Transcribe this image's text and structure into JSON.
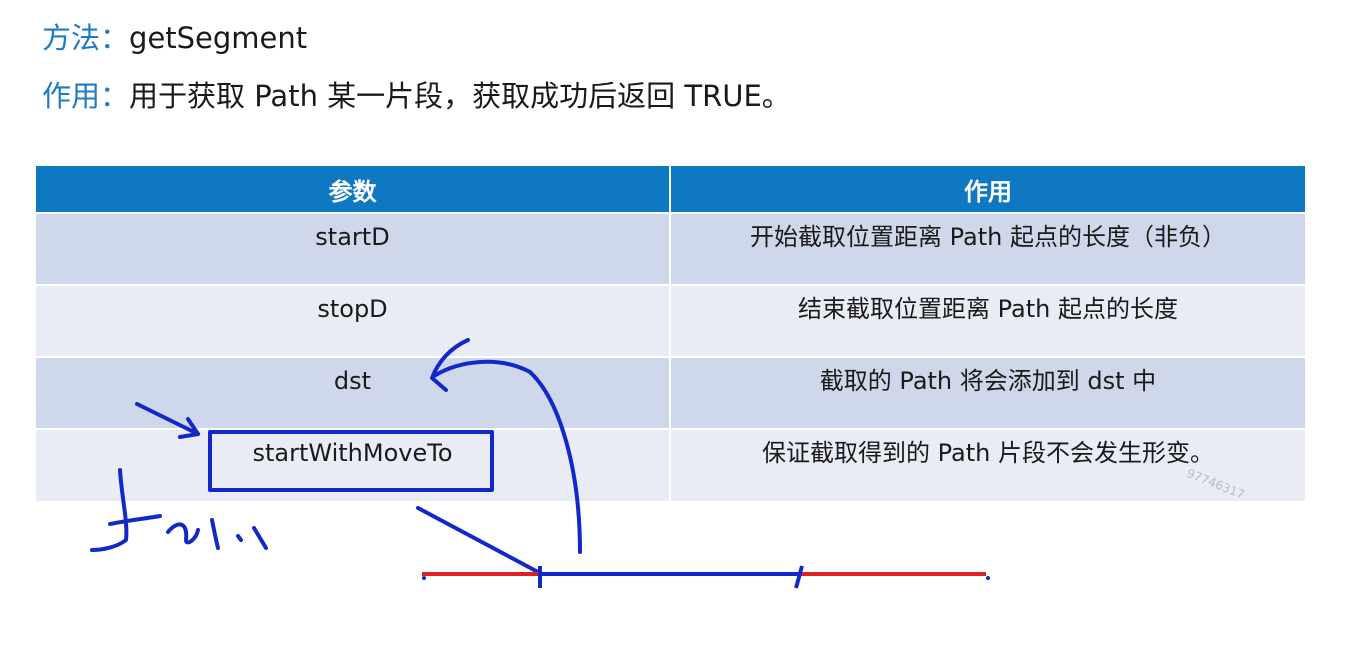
{
  "header": {
    "method_key": "方法",
    "method_value": "getSegment",
    "effect_key": "作用",
    "effect_value": "用于获取 Path 某一片段，获取成功后返回 TRUE。",
    "separator": "："
  },
  "table": {
    "columns": [
      "参数",
      "作用"
    ],
    "rows": [
      {
        "param": "startD",
        "effect": "开始截取位置距离 Path 起点的长度（非负）"
      },
      {
        "param": "stopD",
        "effect": "结束截取位置距离 Path 起点的长度"
      },
      {
        "param": "dst",
        "effect": "截取的 Path 将会添加到 dst 中"
      },
      {
        "param": "startWithMoveTo",
        "effect": "保证截取得到的 Path 片段不会发生形变。"
      }
    ]
  },
  "watermark": "97746317",
  "colors": {
    "accent": "#1f7bc1",
    "header_bg": "#0f78c2",
    "row_dark": "#cfd8ea",
    "row_light": "#e9ecf5",
    "ink_blue": "#1328c8",
    "ink_red": "#e02020"
  }
}
